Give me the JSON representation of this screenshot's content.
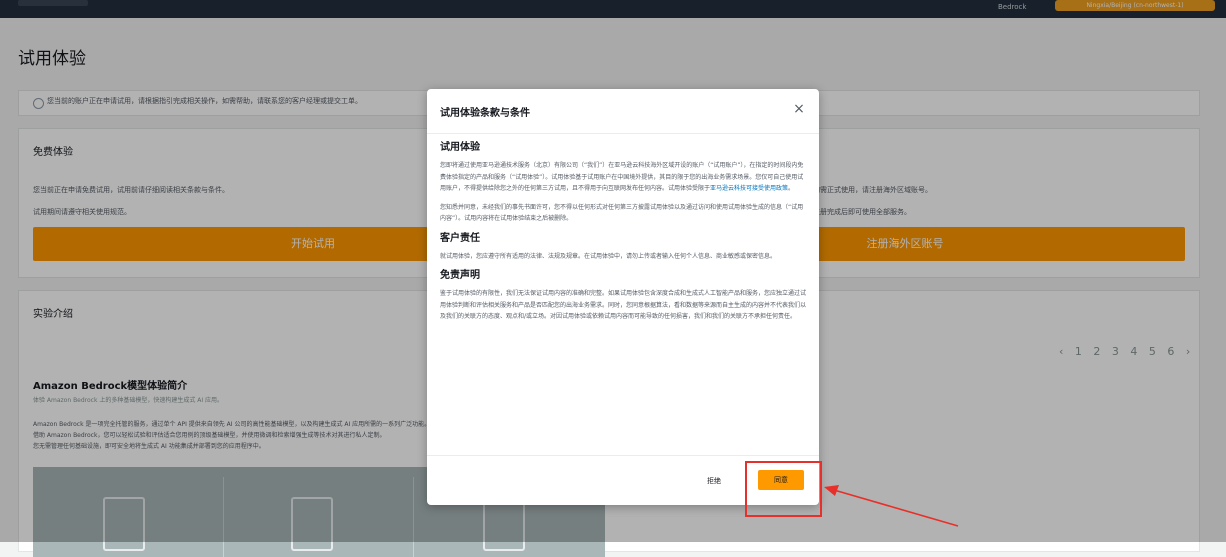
{
  "topbar": {
    "user": "Bedrock",
    "region": "Ningxia/Beijing (cn-northwest-1)"
  },
  "page": {
    "title": "试用体验"
  },
  "notice": {
    "text": "您当前的账户正在申请试用，请根据指引完成相关操作，如需帮助，请联系您的客户经理或提交工单。"
  },
  "free": {
    "title": "免费体验",
    "text1": "您当前正在申请免费试用，试用前请仔细阅读相关条款与条件。",
    "text2": "试用期间请遵守相关使用规范。",
    "text3": "如需正式使用，请注册海外区域账号。",
    "text4": "注册完成后即可使用全部服务。",
    "start_label": "开始试用",
    "register_label": "注册海外区账号"
  },
  "intro": {
    "title": "实验介绍",
    "heading": "Amazon Bedrock模型体验简介",
    "sub": "体验 Amazon Bedrock 上的多种基础模型，快速构建生成式 AI 应用。",
    "body_lines": [
      "Amazon Bedrock 是一项完全托管的服务，通过单个 API 提供来自领先 AI 公司的高性能基础模型，以及构建生成式 AI 应用所需的一系列广泛功能。",
      "借助 Amazon Bedrock，您可以轻松试验和评估适合您用例的顶级基础模型，并使用微调和检索增强生成等技术对其进行私人定制。",
      "您无需管理任何基础设施，即可安全地将生成式 AI 功能集成并部署到您的应用程序中。"
    ],
    "pager": "‹ 1 2 3 4 5 6 ›"
  },
  "modal": {
    "title": "试用体验条款与条件",
    "close": "×",
    "sec1_title": "试用体验",
    "sec1_para1": "您即将通过使用亚马逊通技术服务（北京）有限公司（“我们”）在亚马逊云科技海外区域开设的账户（“试用账户”），在指定的时间段内免费体验指定的产品和服务（“试用体验”）。试用体验基于试用账户在中国境外提供，其目的限于您的出海业务需求场景。您仅可自己使用试用账户，不得提供给除您之外的任何第三方试用，且不得用于向互联网发布任何内容。试用体验受限于",
    "sec1_link": "亚马逊云科技可接受使用政策",
    "sec1_end": "。",
    "sec1_para2": "您知悉并同意，未经我们的事先书面许可，您不得以任何形式对任何第三方披露试用体验以及通过访问和使用试用体验生成的信息（“试用内容”）。试用内容将在试用体验结束之后被删除。",
    "sec2_title": "客户责任",
    "sec2_para": "就试用体验，您应遵守所有适用的法律、法规及规章。在试用体验中，请勿上传或者输入任何个人信息、商业敏感或保密信息。",
    "sec3_title": "免责声明",
    "sec3_para": "鉴于试用体验的有限性，我们无法保证试用内容的准确和完整。如果试用体验包含深度合成和生成式人工智能产品和服务，您应独立通过试用体验判断和评估相关服务和产品是否匹配您的出海业务需求。同时，您同意根据算法，看和数据等来源而自主生成的内容并不代表我们以及我们的关联方的态度、观点和/或立场。对因试用体验或依赖试用内容而可能导致的任何损害，我们和我们的关联方不承担任何责任。",
    "reject_label": "拒绝",
    "agree_label": "同意"
  },
  "colors": {
    "accent": "#ff9900",
    "highlight": "#e8302a",
    "link": "#0073bb"
  }
}
